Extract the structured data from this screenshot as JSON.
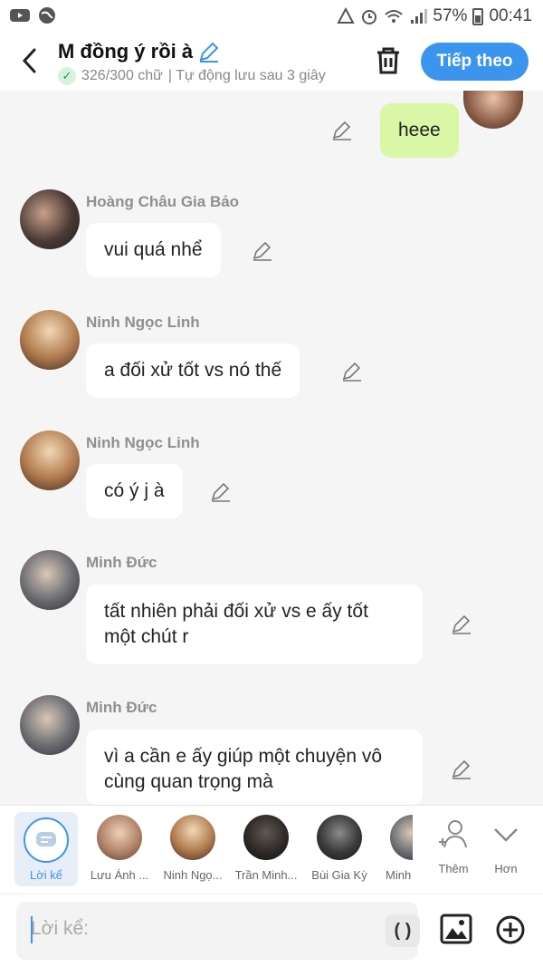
{
  "status": {
    "battery": "57%",
    "time": "00:41"
  },
  "header": {
    "title": "M đồng ý rồi à",
    "counter": "326/300 chữ",
    "autosave": "| Tự động lưu sau 3 giây",
    "next_label": "Tiếp theo"
  },
  "messages": [
    {
      "name": "",
      "text": "heee"
    },
    {
      "name": "Hoàng Châu Gia Bảo",
      "text": "vui quá nhể"
    },
    {
      "name": "Ninh Ngọc Linh",
      "text": "a đối xử tốt vs nó thế"
    },
    {
      "name": "Ninh Ngọc Linh",
      "text": "có ý j à"
    },
    {
      "name": "Minh Đức",
      "text": "tất nhiên phải đối xử vs e ấy tốt một chút r"
    },
    {
      "name": "Minh Đức",
      "text": "vì a cần e ấy giúp một chuyện vô cùng quan trọng mà"
    }
  ],
  "strip": {
    "narrator": "Lời kể",
    "chars": [
      "Lưu Ánh ...",
      "Ninh Ngọ...",
      "Trần Minh...",
      "Bùi Gia Kỳ",
      "Minh"
    ],
    "add": "Thêm",
    "more": "Hơn"
  },
  "input": {
    "placeholder": "Lời kể:",
    "paren": "( )"
  },
  "colors": {
    "accent": "#3b94ee",
    "mine_bubble": "#d9f7a7"
  }
}
